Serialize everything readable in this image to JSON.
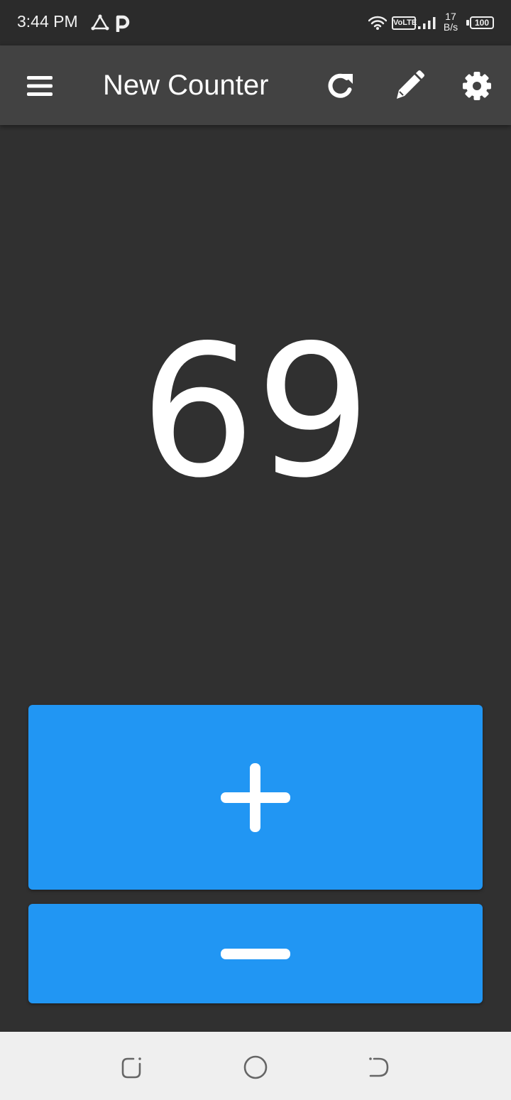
{
  "status_bar": {
    "time": "3:44 PM",
    "network_badge": "VoLTE",
    "net_speed_value": "17",
    "net_speed_unit": "B/s",
    "battery": "100",
    "icons": [
      "triangle-app-icon",
      "p-app-icon",
      "wifi-icon",
      "signal-icon",
      "battery-icon"
    ]
  },
  "app_bar": {
    "title": "New Counter",
    "icons": [
      "menu-icon",
      "reset-icon",
      "edit-icon",
      "settings-icon"
    ]
  },
  "counter": {
    "value": "69"
  },
  "buttons": {
    "increment_icon": "plus-icon",
    "decrement_icon": "minus-icon",
    "color": "#2196f3"
  },
  "nav_bar": {
    "icons": [
      "recents-icon",
      "home-icon",
      "back-icon"
    ]
  },
  "colors": {
    "background": "#303030",
    "app_bar": "#424242",
    "accent": "#2196f3",
    "nav_bar": "#efefef"
  }
}
